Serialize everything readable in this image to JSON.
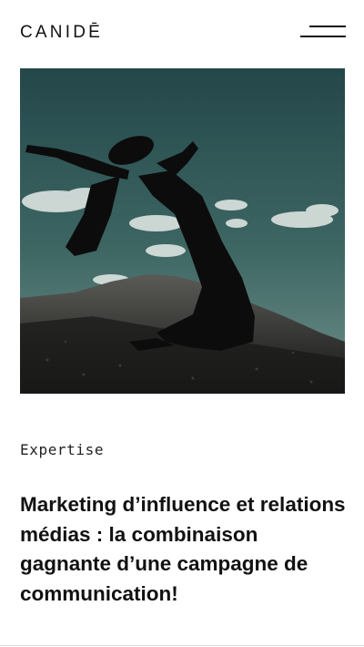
{
  "header": {
    "logo_text": "CANIDĒ",
    "menu_icon": "hamburger-menu-icon"
  },
  "article": {
    "category": "Expertise",
    "title": "Marketing d’influence et relations médias : la combinaison gagnante d’une campagne de communication!"
  },
  "colors": {
    "text": "#111111",
    "background": "#ffffff",
    "sky": "#2e5552"
  }
}
